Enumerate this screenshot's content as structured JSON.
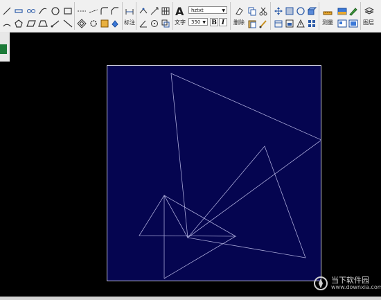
{
  "toolbar": {
    "annotate_label": "标注",
    "text_label": "文字",
    "text_tool_glyph": "A",
    "font_combo": "hztxt",
    "size_combo": "350",
    "bold_label": "B",
    "italic_label": "I",
    "delete_label": "删除",
    "measure_label": "测量",
    "layer_label": "图层",
    "icons": [
      "line-icon",
      "polyline-icon",
      "chain-icon",
      "spline-icon",
      "circle-icon",
      "rectangle-icon",
      "cloud-icon",
      "arc-icon",
      "polygon-icon",
      "parallelogram-icon",
      "trapezoid-icon",
      "ray-icon",
      "xline-icon",
      "dimension-icon",
      "hatch-icon",
      "fill-icon",
      "eraser-icon",
      "copy-icon",
      "move-icon",
      "rotate-icon",
      "scale-icon",
      "mirror-icon",
      "array-icon",
      "measure-icon",
      "layer-icon"
    ]
  },
  "watermark": {
    "title": "当下软件园",
    "url": "www.downxia.com"
  },
  "colors": {
    "paper": "#050550",
    "geometry": "#a8a8d8",
    "background": "#000000"
  }
}
